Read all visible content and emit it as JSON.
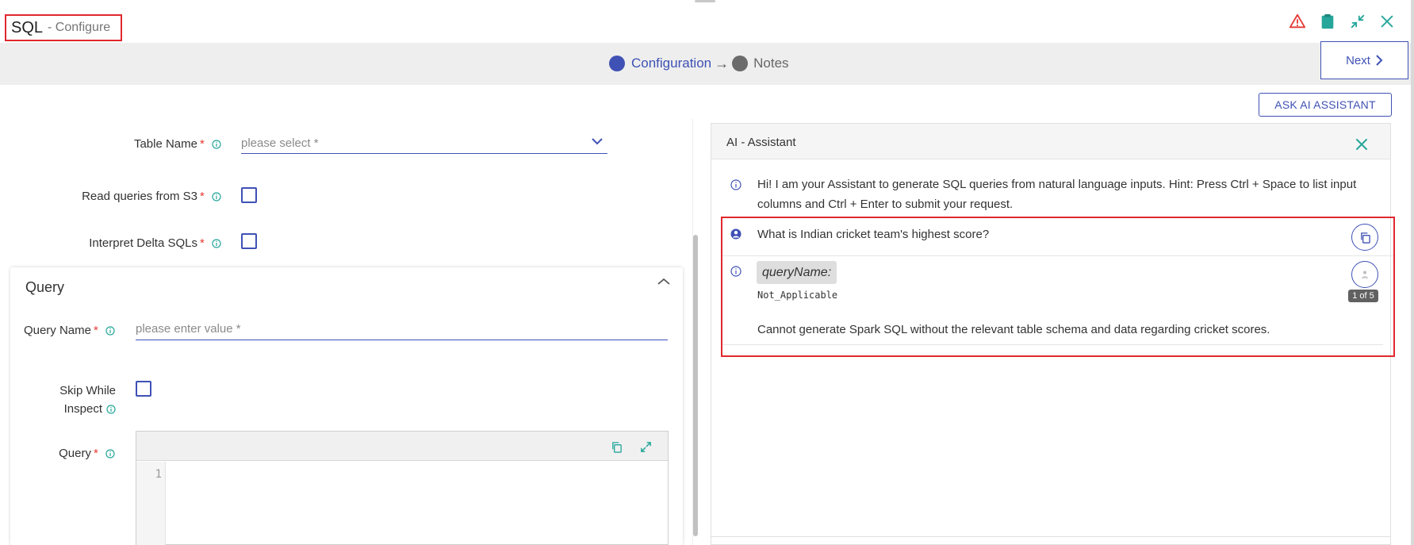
{
  "header": {
    "title": "SQL",
    "subtitle": "- Configure",
    "icons": [
      "warning-icon",
      "clipboard-icon",
      "collapse-icon",
      "close-icon"
    ]
  },
  "stepper": {
    "steps": [
      {
        "label": "Configuration",
        "state": "active"
      },
      {
        "label": "Notes",
        "state": "inactive"
      }
    ],
    "arrow": "→",
    "next_label": "Next"
  },
  "form": {
    "table_name": {
      "label": "Table Name",
      "required": "*",
      "placeholder": "please select *"
    },
    "read_queries_s3": {
      "label": "Read queries from S3",
      "required": "*",
      "checked": false
    },
    "interpret_delta": {
      "label": "Interpret Delta SQLs",
      "required": "*",
      "checked": false
    }
  },
  "query_section": {
    "title": "Query",
    "query_name": {
      "label": "Query Name",
      "required": "*",
      "placeholder": "please enter value *"
    },
    "skip_while_inspect": {
      "label_line1": "Skip While",
      "label_line2": "Inspect",
      "checked": false
    },
    "query": {
      "label": "Query",
      "required": "*",
      "line_number": "1"
    }
  },
  "ai_assistant": {
    "ask_button": "ASK AI ASSISTANT",
    "panel_title": "AI - Assistant",
    "intro_line1": "Hi! I am your Assistant to generate SQL queries from natural language inputs. Hint: Press Ctrl + Space to list input",
    "intro_line2": "columns and Ctrl + Enter to submit your request.",
    "user_question": "What is Indian cricket team's highest score?",
    "response_key": "queryName:",
    "response_value": "Not_Applicable",
    "response_counter": "1 of 5",
    "response_text": "Cannot generate Spark SQL without the relevant table schema and data regarding cricket scores."
  },
  "colors": {
    "accent": "#3f51b5",
    "highlight_border": "#e0282e",
    "teal_icon": "#26a69a",
    "inactive_step": "#616161"
  }
}
